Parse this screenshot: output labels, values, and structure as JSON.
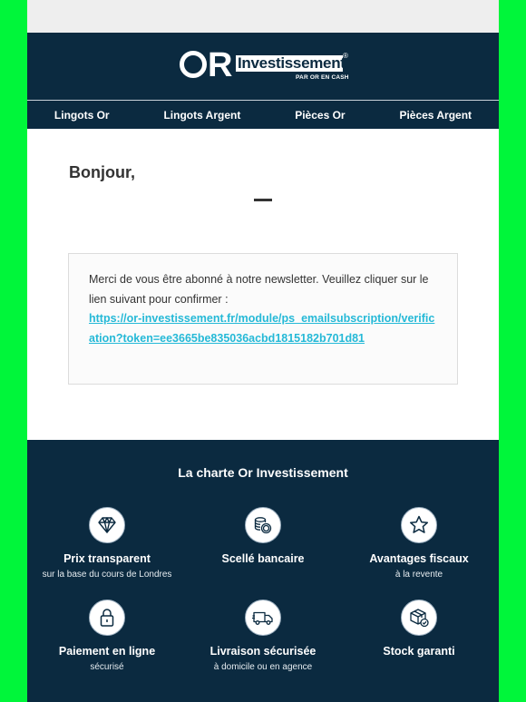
{
  "brand": {
    "logo_main": "OR",
    "logo_word": "Investissement",
    "logo_mark": "®",
    "logo_tagline": "PAR OR EN CASH"
  },
  "nav": [
    {
      "label": "Lingots Or"
    },
    {
      "label": "Lingots Argent"
    },
    {
      "label": "Pièces Or"
    },
    {
      "label": "Pièces Argent"
    }
  ],
  "greeting": "Bonjour,",
  "message": {
    "text": "Merci de vous être abonné à notre newsletter. Veuillez cliquer sur le lien suivant pour confirmer :",
    "link": "https://or-investissement.fr/module/ps_emailsubscription/verification?token=ee3665be835036acbd1815182b701d81"
  },
  "charter": {
    "title": "La charte Or Investissement",
    "features": [
      {
        "icon": "diamond-icon",
        "title": "Prix transparent",
        "subtitle": "sur la base du cours de Londres"
      },
      {
        "icon": "coins-icon",
        "title": "Scellé bancaire",
        "subtitle": ""
      },
      {
        "icon": "star-icon",
        "title": "Avantages fiscaux",
        "subtitle": "à la revente"
      },
      {
        "icon": "padlock-icon",
        "title": "Paiement en ligne",
        "subtitle": "sécurisé"
      },
      {
        "icon": "truck-icon",
        "title": "Livraison sécurisée",
        "subtitle": "à domicile ou en agence"
      },
      {
        "icon": "box-check-icon",
        "title": "Stock garanti",
        "subtitle": ""
      }
    ]
  },
  "colors": {
    "navy": "#0b2a40",
    "link": "#25b9d7",
    "outer_background": "#00f63a"
  }
}
